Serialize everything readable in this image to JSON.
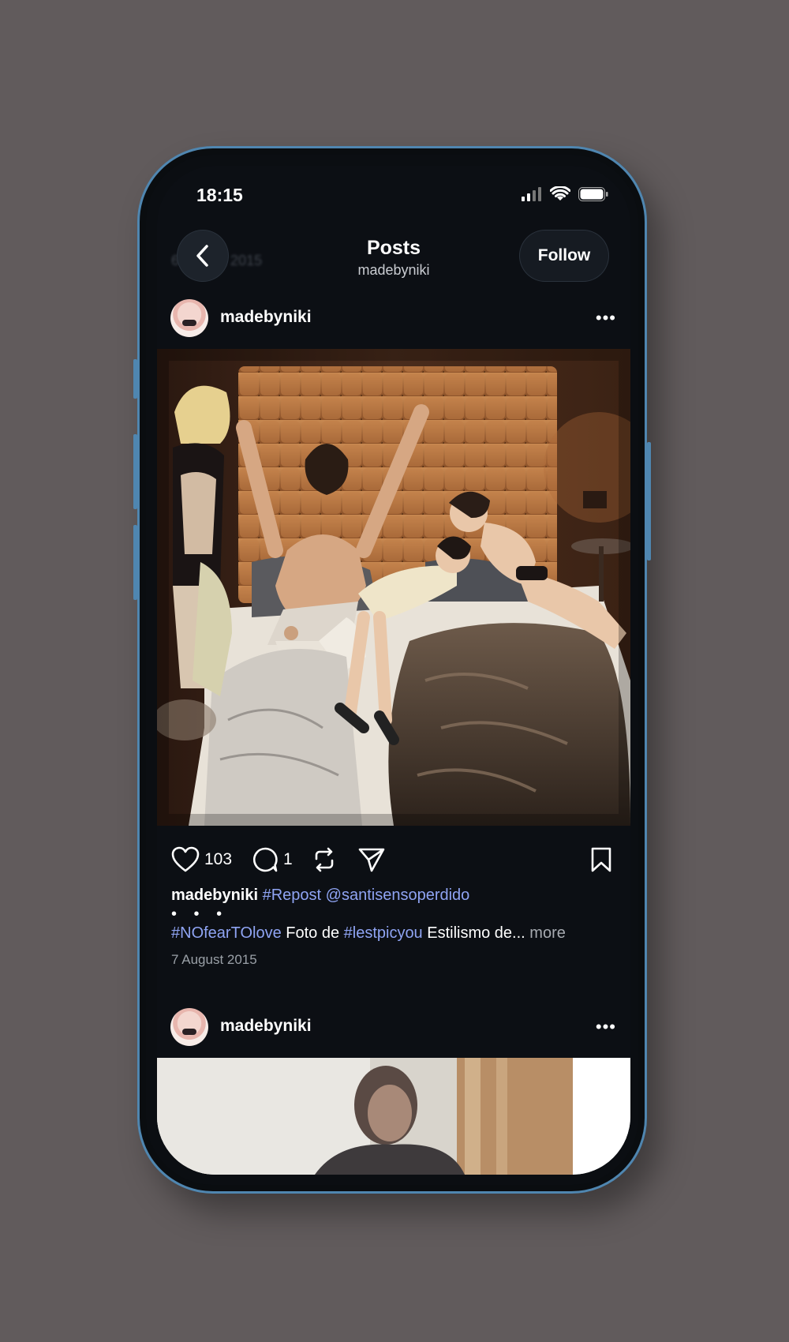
{
  "status_bar": {
    "time": "18:15"
  },
  "nav": {
    "title": "Posts",
    "subtitle": "madebyniki",
    "follow_label": "Follow",
    "ghost_date": "6 August 2015"
  },
  "posts": [
    {
      "username": "madebyniki",
      "likes": "103",
      "comments": "1",
      "caption_user": "madebyniki",
      "caption_line1_tags": "#Repost @santisensoperdido",
      "caption_dots": "• • •",
      "caption_tag1": "#NOfearTOlove",
      "caption_text1": " Foto de ",
      "caption_tag2": "#lestpicyou",
      "caption_text2": " Estilismo de...",
      "more_label": "more",
      "date": "7 August 2015"
    },
    {
      "username": "madebyniki"
    }
  ],
  "colors": {
    "background": "#615b5c",
    "screen": "#0c0f14",
    "hashtag": "#8fa4f3",
    "frame": "#4f86b0"
  }
}
